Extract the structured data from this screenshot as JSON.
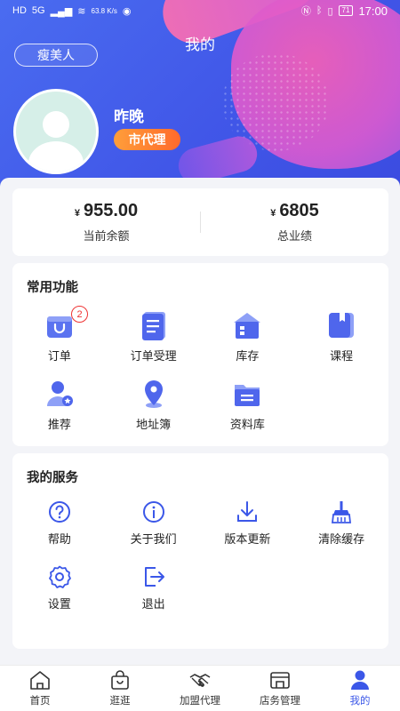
{
  "status_bar": {
    "left_labels": [
      "HD",
      "5G",
      "63.8 K/s"
    ],
    "battery": "71",
    "time": "17:00"
  },
  "header": {
    "title": "我的",
    "tag_button": "瘦美人",
    "username": "昨晚",
    "role_badge": "市代理",
    "colors": {
      "primary": "#4157e8",
      "accent_pink": "#f45fb6",
      "badge_orange": "#ff7a2f"
    }
  },
  "stats": [
    {
      "currency": "¥",
      "value": "955.00",
      "label": "当前余额"
    },
    {
      "currency": "¥",
      "value": "6805",
      "label": "总业绩"
    }
  ],
  "common_functions": {
    "title": "常用功能",
    "items": [
      {
        "label": "订单",
        "icon": "shopping-bag-icon",
        "badge": "2"
      },
      {
        "label": "订单受理",
        "icon": "document-list-icon"
      },
      {
        "label": "库存",
        "icon": "warehouse-icon"
      },
      {
        "label": "课程",
        "icon": "book-icon"
      },
      {
        "label": "推荐",
        "icon": "user-star-icon"
      },
      {
        "label": "地址簿",
        "icon": "location-pin-icon"
      },
      {
        "label": "资料库",
        "icon": "folder-icon"
      }
    ]
  },
  "services": {
    "title": "我的服务",
    "items": [
      {
        "label": "帮助",
        "icon": "help-icon"
      },
      {
        "label": "关于我们",
        "icon": "info-icon"
      },
      {
        "label": "版本更新",
        "icon": "download-icon"
      },
      {
        "label": "清除缓存",
        "icon": "broom-icon"
      },
      {
        "label": "设置",
        "icon": "settings-icon"
      },
      {
        "label": "退出",
        "icon": "logout-icon"
      }
    ]
  },
  "tabbar": [
    {
      "label": "首页",
      "icon": "home-icon",
      "active": false
    },
    {
      "label": "逛逛",
      "icon": "shopping-bag-icon",
      "active": false
    },
    {
      "label": "加盟代理",
      "icon": "handshake-icon",
      "active": false
    },
    {
      "label": "店务管理",
      "icon": "store-icon",
      "active": false
    },
    {
      "label": "我的",
      "icon": "user-icon",
      "active": true
    }
  ]
}
